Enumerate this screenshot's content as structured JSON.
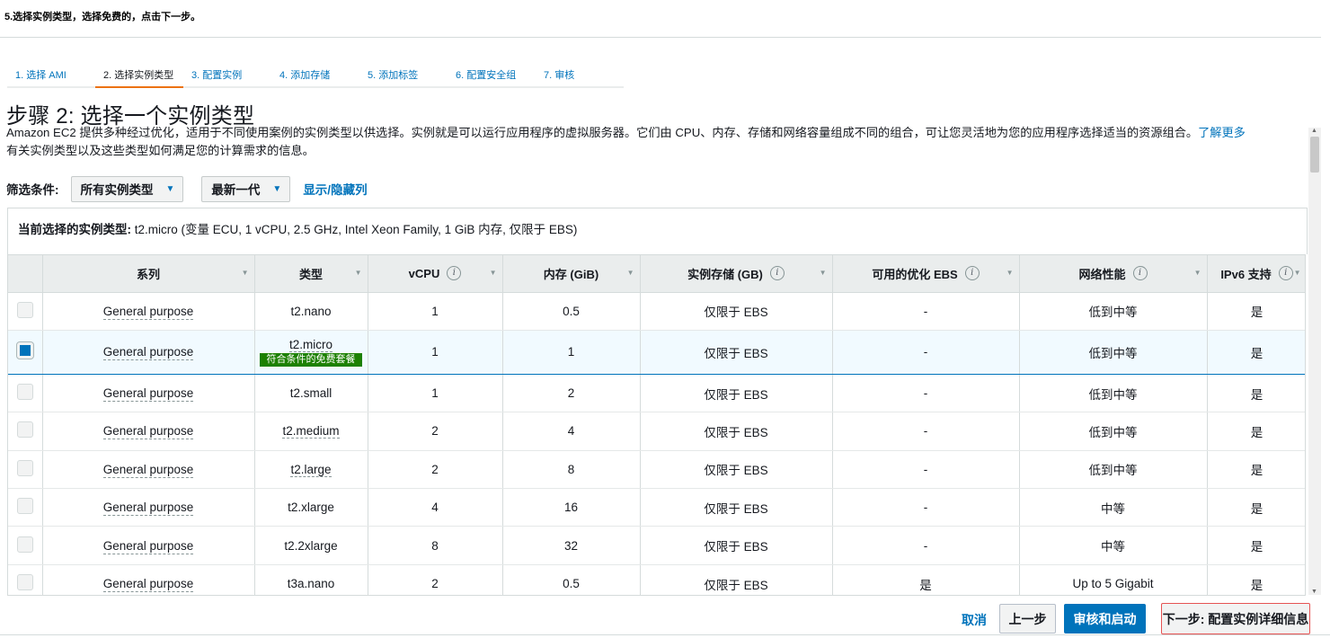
{
  "doc_note": "5.选择实例类型，选择免费的，点击下一步。",
  "wizard": {
    "steps": [
      "1. 选择 AMI",
      "2. 选择实例类型",
      "3. 配置实例",
      "4. 添加存储",
      "5. 添加标签",
      "6. 配置安全组",
      "7. 审核"
    ],
    "active_index": 1
  },
  "page": {
    "title": "步骤 2: 选择一个实例类型",
    "description": "Amazon EC2 提供多种经过优化，适用于不同使用案例的实例类型以供选择。实例就是可以运行应用程序的虚拟服务器。它们由 CPU、内存、存储和网络容量组成不同的组合，可让您灵活地为您的应用程序选择适当的资源组合。",
    "learn_more": "了解更多",
    "description_tail": "有关实例类型以及这些类型如何满足您的计算需求的信息。"
  },
  "filter": {
    "label": "筛选条件:",
    "select_all": "所有实例类型",
    "select_gen": "最新一代",
    "toggle_columns": "显示/隐藏列"
  },
  "current": {
    "label": "当前选择的实例类型:",
    "value": "t2.micro (变量 ECU, 1 vCPU, 2.5 GHz, Intel Xeon Family, 1 GiB 内存, 仅限于 EBS)"
  },
  "table": {
    "headers": [
      "系列",
      "类型",
      "vCPU",
      "内存 (GiB)",
      "实例存储 (GB)",
      "可用的优化 EBS",
      "网络性能",
      "IPv6 支持"
    ],
    "info_columns": [
      2,
      4,
      5,
      6,
      7
    ],
    "free_tier_badge": "符合条件的免费套餐",
    "rows": [
      {
        "family": "General purpose",
        "type": "t2.nano",
        "vcpu": "1",
        "memory": "0.5",
        "storage": "仅限于 EBS",
        "ebs": "-",
        "network": "低到中等",
        "ipv6": "是",
        "selected": false,
        "free": false
      },
      {
        "family": "General purpose",
        "type": "t2.micro",
        "vcpu": "1",
        "memory": "1",
        "storage": "仅限于 EBS",
        "ebs": "-",
        "network": "低到中等",
        "ipv6": "是",
        "selected": true,
        "free": true
      },
      {
        "family": "General purpose",
        "type": "t2.small",
        "vcpu": "1",
        "memory": "2",
        "storage": "仅限于 EBS",
        "ebs": "-",
        "network": "低到中等",
        "ipv6": "是",
        "selected": false,
        "free": false
      },
      {
        "family": "General purpose",
        "type": "t2.medium",
        "vcpu": "2",
        "memory": "4",
        "storage": "仅限于 EBS",
        "ebs": "-",
        "network": "低到中等",
        "ipv6": "是",
        "selected": false,
        "free": false
      },
      {
        "family": "General purpose",
        "type": "t2.large",
        "vcpu": "2",
        "memory": "8",
        "storage": "仅限于 EBS",
        "ebs": "-",
        "network": "低到中等",
        "ipv6": "是",
        "selected": false,
        "free": false
      },
      {
        "family": "General purpose",
        "type": "t2.xlarge",
        "vcpu": "4",
        "memory": "16",
        "storage": "仅限于 EBS",
        "ebs": "-",
        "network": "中等",
        "ipv6": "是",
        "selected": false,
        "free": false
      },
      {
        "family": "General purpose",
        "type": "t2.2xlarge",
        "vcpu": "8",
        "memory": "32",
        "storage": "仅限于 EBS",
        "ebs": "-",
        "network": "中等",
        "ipv6": "是",
        "selected": false,
        "free": false
      },
      {
        "family": "General purpose",
        "type": "t3a.nano",
        "vcpu": "2",
        "memory": "0.5",
        "storage": "仅限于 EBS",
        "ebs": "是",
        "network": "Up to 5 Gigabit",
        "ipv6": "是",
        "selected": false,
        "free": false
      }
    ]
  },
  "footer": {
    "cancel": "取消",
    "previous": "上一步",
    "review_launch": "审核和启动",
    "next": "下一步: 配置实例详细信息"
  }
}
